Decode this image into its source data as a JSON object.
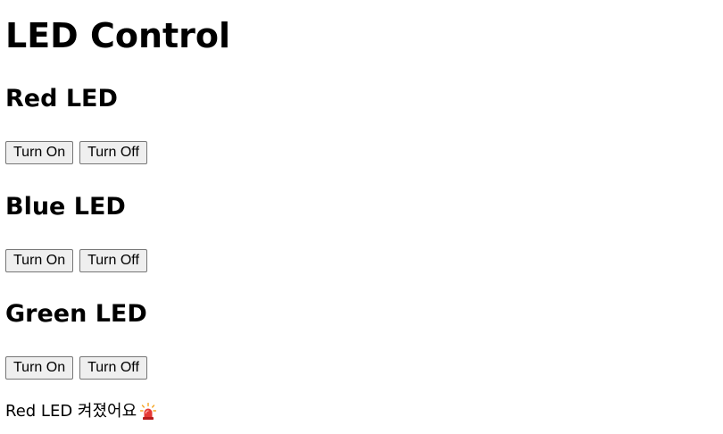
{
  "page": {
    "title": "LED Control"
  },
  "sections": [
    {
      "heading": "Red LED",
      "on_label": "Turn On",
      "off_label": "Turn Off"
    },
    {
      "heading": "Blue LED",
      "on_label": "Turn On",
      "off_label": "Turn Off"
    },
    {
      "heading": "Green LED",
      "on_label": "Turn On",
      "off_label": "Turn Off"
    }
  ],
  "status": {
    "text": "Red LED 켜졌어요",
    "icon": "rotating-light-icon"
  },
  "colors": {
    "button_bg": "#efefef",
    "button_border": "#767676",
    "siren_red": "#e53935",
    "siren_ray": "#f5a623"
  }
}
